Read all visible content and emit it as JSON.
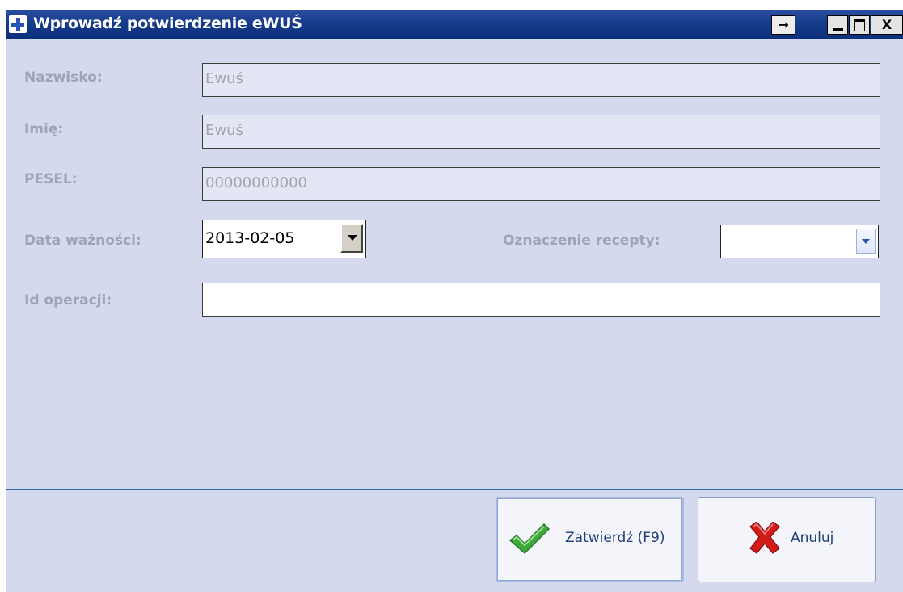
{
  "window": {
    "title": "Wprowadź potwierdzenie eWUŚ",
    "title_buttons": {
      "back": "→",
      "minimize": "minimize",
      "maximize": "maximize",
      "close": "X"
    }
  },
  "form": {
    "nazwisko": {
      "label": "Nazwisko:",
      "value": "Ewuś"
    },
    "imie": {
      "label": "Imię:",
      "value": "Ewuś"
    },
    "pesel": {
      "label": "PESEL:",
      "value": "00000000000"
    },
    "data_waznosci": {
      "label": "Data ważności:",
      "value": "2013-02-05"
    },
    "oznaczenie_recepty": {
      "label": "Oznaczenie recepty:",
      "value": ""
    },
    "id_operacji": {
      "label": "Id operacji:",
      "value": ""
    }
  },
  "buttons": {
    "confirm": "Zatwierdź (F9)",
    "cancel": "Anuluj"
  },
  "colors": {
    "titlebar": "#163c8c",
    "background": "#d5d9ed",
    "label": "#9ea3b5",
    "separator": "#2e6aa8",
    "button_text": "#1f3d78",
    "check": "#3fa83a",
    "cancel_x": "#d11b1b"
  },
  "icons": {
    "app": "plus-icon",
    "confirm": "check-icon",
    "cancel": "x-icon"
  }
}
